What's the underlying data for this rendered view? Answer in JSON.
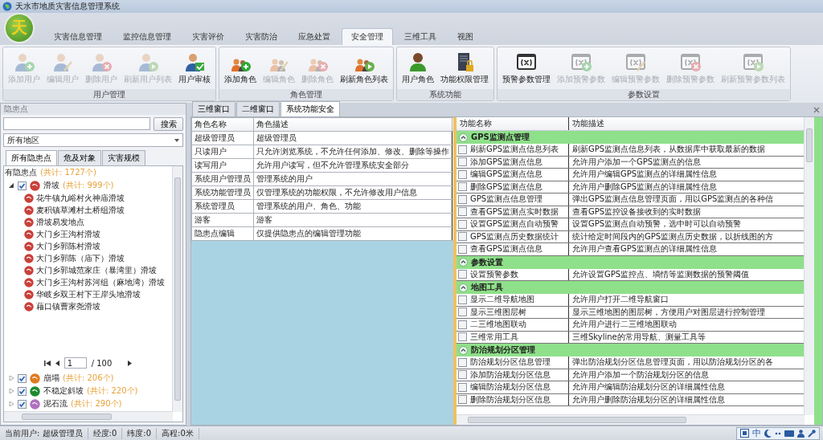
{
  "window": {
    "title": "天水市地质灾害信息管理系统"
  },
  "logo": {
    "text": "天"
  },
  "ribbon": {
    "tabs": [
      {
        "label": "灾害信息管理",
        "selected": false
      },
      {
        "label": "监控信息管理",
        "selected": false
      },
      {
        "label": "灾害评价",
        "selected": false
      },
      {
        "label": "灾害防治",
        "selected": false
      },
      {
        "label": "应急处置",
        "selected": false
      },
      {
        "label": "安全管理",
        "selected": true
      },
      {
        "label": "三维工具",
        "selected": false
      },
      {
        "label": "视图",
        "selected": false
      }
    ],
    "groups": [
      {
        "label": "用户管理",
        "buttons": [
          {
            "label": "添加用户",
            "disabled": true
          },
          {
            "label": "编辑用户",
            "disabled": true
          },
          {
            "label": "删除用户",
            "disabled": true
          },
          {
            "label": "刷新用户列表",
            "disabled": true
          },
          {
            "label": "用户审核",
            "disabled": false
          }
        ]
      },
      {
        "label": "角色管理",
        "buttons": [
          {
            "label": "添加角色",
            "disabled": false
          },
          {
            "label": "编辑角色",
            "disabled": true
          },
          {
            "label": "删除角色",
            "disabled": true
          },
          {
            "label": "刷新角色列表",
            "disabled": false
          }
        ]
      },
      {
        "label": "系统功能",
        "buttons": [
          {
            "label": "用户角色",
            "disabled": false
          },
          {
            "label": "功能权限管理",
            "disabled": false
          }
        ]
      },
      {
        "label": "参数设置",
        "buttons": [
          {
            "label": "预警参数管理",
            "disabled": false
          },
          {
            "label": "添加预警参数",
            "disabled": true
          },
          {
            "label": "编辑预警参数",
            "disabled": true
          },
          {
            "label": "删除预警参数",
            "disabled": true
          },
          {
            "label": "刷新预警参数列表",
            "disabled": true
          }
        ]
      }
    ]
  },
  "left_panel": {
    "title": "隐患点",
    "search_button": "搜索",
    "region_dropdown": "所有地区",
    "tabs": [
      {
        "label": "所有隐患点",
        "selected": true
      },
      {
        "label": "危及对象",
        "selected": false
      },
      {
        "label": "灾害规模",
        "selected": false
      }
    ],
    "tree": {
      "root": {
        "label": "有隐患点",
        "count": "(共计: 1727个)"
      },
      "categories": [
        {
          "label": "滑坡",
          "count": "(共计: 999个)",
          "checked": true,
          "expanded": true,
          "color": "#c9403a",
          "children": [
            "花牛镇九峪村火神庙滑坡",
            "麦积镇草滩村土桥组滑坡",
            "滑坡易发地点",
            "大门乡王沟村滑坡",
            "大门乡郭陈村滑坡",
            "大门乡郭陈（庙下）滑坡",
            "大门乡郭城范家庄（暴湾里）滑坡",
            "大门乡王沟村苏河组（麻地湾）滑坡",
            "华岐乡双王村下王岸头地滑坡",
            "藉口镇曹家尧滑坡"
          ],
          "pagination": {
            "page": "1",
            "total": "/ 100"
          }
        },
        {
          "label": "崩塌",
          "count": "(共计: 206个)",
          "checked": true,
          "expanded": false,
          "color": "#e07b20"
        },
        {
          "label": "不稳定斜坡",
          "count": "(共计: 220个)",
          "checked": true,
          "expanded": false,
          "color": "#1e8a2e"
        },
        {
          "label": "泥石流",
          "count": "(共计: 290个)",
          "checked": true,
          "expanded": false,
          "color": "#b070c0"
        }
      ]
    }
  },
  "document_tabs": [
    {
      "label": "三维窗口",
      "selected": false
    },
    {
      "label": "二维窗口",
      "selected": false
    },
    {
      "label": "系统功能安全",
      "selected": true
    }
  ],
  "role_table": {
    "columns": [
      "角色名称",
      "角色描述"
    ],
    "rows": [
      [
        "超级管理员",
        "超级管理员"
      ],
      [
        "只读用户",
        "只允许浏览系统，不允许任何添加、修改、删除等操作"
      ],
      [
        "读写用户",
        "允许用户读写，但不允许管理系统安全部分"
      ],
      [
        "系统用户管理员",
        "管理系统的用户"
      ],
      [
        "系统功能管理员",
        "仅管理系统的功能权限，不允许修改用户信息"
      ],
      [
        "系统管理员",
        "管理系统的用户、角色、功能"
      ],
      [
        "游客",
        "游客"
      ],
      [
        "隐患点编辑",
        "仅提供隐患点的编辑管理功能"
      ]
    ]
  },
  "function_table": {
    "columns": [
      "功能名称",
      "功能描述"
    ],
    "groups": [
      {
        "label": "GPS监测点管理",
        "expanded": true,
        "items": [
          {
            "name": "刷新GPS监测点信息列表",
            "description": "刷新GPS监测点信息列表，从数据库中获取最新的数据",
            "checked": false
          },
          {
            "name": "添加GPS监测点信息",
            "description": "允许用户添加一个GPS监测点的信息",
            "checked": false
          },
          {
            "name": "编辑GPS监测点信息",
            "description": "允许用户编辑GPS监测点的详细属性信息",
            "checked": false
          },
          {
            "name": "删除GPS监测点信息",
            "description": "允许用户删除GPS监测点的详细属性信息",
            "checked": false
          },
          {
            "name": "GPS监测点信息管理",
            "description": "弹出GPS监测点信息管理页面，用以GPS监测点的各种信",
            "checked": false
          },
          {
            "name": "查看GPS监测点实时数据",
            "description": "查看GPS监控设备接收到的实时数据",
            "checked": false
          },
          {
            "name": "设置GPS监测点自动预警",
            "description": "设置GPS监测点自动预警，选中时可以自动预警",
            "checked": false
          },
          {
            "name": "GPS监测点历史数据统计",
            "description": "统计给定时间段内的GPS监测点历史数据，以折线图的方",
            "checked": false
          },
          {
            "name": "查看GPS监测点信息",
            "description": "允许用户查看GPS监测点的详细属性信息",
            "checked": false
          }
        ]
      },
      {
        "label": "参数设置",
        "expanded": true,
        "items": [
          {
            "name": "设置预警参数",
            "description": "允许设置GPS监控点、墒情等监测数据的预警阈值",
            "checked": false
          }
        ]
      },
      {
        "label": "地图工具",
        "expanded": true,
        "items": [
          {
            "name": "显示二维导航地图",
            "description": "允许用户打开二维导航窗口",
            "checked": false
          },
          {
            "name": "显示三维图层树",
            "description": "显示三维地图的图层树，方便用户对图层进行控制管理",
            "checked": false
          },
          {
            "name": "二三维地图联动",
            "description": "允许用户进行二三维地图联动",
            "checked": false
          },
          {
            "name": "三维常用工具",
            "description": "三维Skyline的常用导航、测量工具等",
            "checked": false
          }
        ]
      },
      {
        "label": "防治规划分区管理",
        "expanded": true,
        "items": [
          {
            "name": "防治规划分区信息管理",
            "description": "弹出防治规划分区信息管理页面，用以防治规划分区的各",
            "checked": false
          },
          {
            "name": "添加防治规划分区信息",
            "description": "允许用户添加一个防治规划分区的信息",
            "checked": false
          },
          {
            "name": "编辑防治规划分区信息",
            "description": "允许用户编辑防治规划分区的详细属性信息",
            "checked": false
          },
          {
            "name": "删除防治规划分区信息",
            "description": "允许用户删除防治规划分区的详细属性信息",
            "checked": false
          }
        ]
      }
    ]
  },
  "status_bar": {
    "items": [
      "当前用户: 超级管理员",
      "经度:0",
      "纬度:0",
      "高程:0米"
    ],
    "tray": {
      "ime": "中"
    }
  }
}
